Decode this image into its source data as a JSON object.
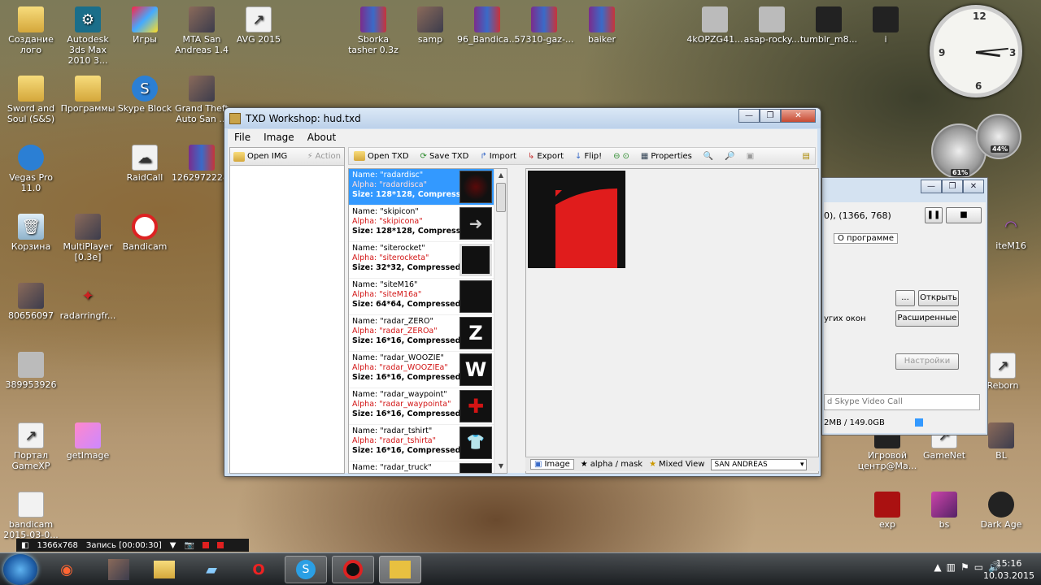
{
  "desktop_icons": [
    {
      "label": "Создание лого",
      "x_col": 0
    },
    {
      "label": "Autodesk 3ds Max 2010 3..."
    },
    {
      "label": "Игры"
    },
    {
      "label": "MTA San Andreas 1.4"
    },
    {
      "label": "AVG 2015"
    },
    {
      "label": "Sborka tasher 0.3z"
    },
    {
      "label": "samp"
    },
    {
      "label": "96_Bandica..."
    },
    {
      "label": "57310-gaz-..."
    },
    {
      "label": "baiker"
    },
    {
      "label": "4kOPZG41..."
    },
    {
      "label": "asap-rocky..."
    },
    {
      "label": "tumblr_m8..."
    },
    {
      "label": "i"
    },
    {
      "label": "Sword and Soul (S&S)"
    },
    {
      "label": "Программы"
    },
    {
      "label": "Skype Block"
    },
    {
      "label": "Grand Theft Auto San ..."
    },
    {
      "label": "Vegas Pro 11.0"
    },
    {
      "label": "RaidCall"
    },
    {
      "label": "1262972224..."
    },
    {
      "label": "Корзина"
    },
    {
      "label": "MultiPlayer [0.3e]"
    },
    {
      "label": "Bandicam"
    },
    {
      "label": "80656097"
    },
    {
      "label": "radarringfr..."
    },
    {
      "label": "389953926"
    },
    {
      "label": "Портал GameXP"
    },
    {
      "label": "getImage"
    },
    {
      "label": "bandicam 2015-03-0..."
    },
    {
      "label": "Игровой центр@Ma..."
    },
    {
      "label": "GameNet"
    },
    {
      "label": "BL"
    },
    {
      "label": "exp"
    },
    {
      "label": "bs"
    },
    {
      "label": "Dark Age"
    },
    {
      "label": "iteM16"
    },
    {
      "label": "Reborn"
    }
  ],
  "gauges": {
    "cpu": "61%",
    "mem": "44%"
  },
  "clock": {
    "hours": 3,
    "minutes": 16
  },
  "window": {
    "title": "TXD Workshop: hud.txd",
    "minimize": "—",
    "maximize": "❐",
    "close": "✕",
    "menu": [
      "File",
      "Image",
      "About"
    ],
    "left_toolbar": {
      "open_img": "Open IMG",
      "action": "Action"
    },
    "toolbar": {
      "open_txd": "Open TXD",
      "save_txd": "Save TXD",
      "import": "Import",
      "export": "Export",
      "flip": "Flip!",
      "properties": "Properties"
    },
    "textures": [
      {
        "name": "Name: \"radardisc\"",
        "alpha": "Alpha: \"radardisca\"",
        "size": "Size: 128*128, Compressed",
        "thumb": "",
        "selected": true
      },
      {
        "name": "Name: \"skipicon\"",
        "alpha": "Alpha: \"skipicona\"",
        "size": "Size: 128*128, Compressed",
        "thumb": "➜",
        "selected": false
      },
      {
        "name": "Name: \"siterocket\"",
        "alpha": "Alpha: \"siterocketa\"",
        "size": "Size: 32*32, Compressed DX",
        "thumb": "",
        "selected": false
      },
      {
        "name": "Name: \"siteM16\"",
        "alpha": "Alpha: \"siteM16a\"",
        "size": "Size: 64*64, Compressed DX",
        "thumb": "",
        "selected": false
      },
      {
        "name": "Name: \"radar_ZERO\"",
        "alpha": "Alpha: \"radar_ZEROa\"",
        "size": "Size: 16*16, Compressed DX",
        "thumb": "Z",
        "selected": false
      },
      {
        "name": "Name: \"radar_WOOZIE\"",
        "alpha": "Alpha: \"radar_WOOZIEa\"",
        "size": "Size: 16*16, Compressed DX",
        "thumb": "W",
        "selected": false
      },
      {
        "name": "Name: \"radar_waypoint\"",
        "alpha": "Alpha: \"radar_waypointa\"",
        "size": "Size: 16*16, Compressed DX",
        "thumb": "✚",
        "selected": false
      },
      {
        "name": "Name: \"radar_tshirt\"",
        "alpha": "Alpha: \"radar_tshirta\"",
        "size": "Size: 16*16, Compressed DX",
        "thumb": "👕",
        "selected": false
      },
      {
        "name": "Name: \"radar_truck\"",
        "alpha": "",
        "size": "",
        "thumb": "",
        "selected": false
      }
    ],
    "status": {
      "image_tab": "Image",
      "alpha_tab": "alpha / mask",
      "mixed_tab": "Mixed View",
      "game_select": "SAN ANDREAS"
    }
  },
  "bandicam_window": {
    "resolution": "0), (1366, 768)",
    "tab_about": "О программе",
    "open_button": "Открыть",
    "browse_button": "...",
    "other_windows": "угих окон",
    "advanced_button": "Расширенные",
    "settings_button": "Настройки",
    "skype_field": "d Skype Video Call",
    "disk": "2MB / 149.0GB"
  },
  "recbar": {
    "resolution": "1366x768",
    "recording": "Запись [00:00:30]"
  },
  "taskbar": {
    "time": "15:16",
    "date": "10.03.2015"
  },
  "colors": {
    "selection": "#3399ff",
    "alpha_text": "#d21414",
    "preview_red": "#e01c1c"
  }
}
